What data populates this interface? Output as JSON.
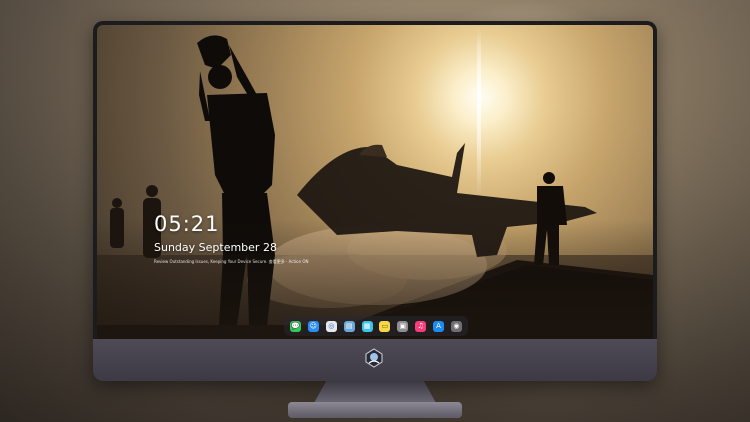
{
  "lockscreen": {
    "time": "05:21",
    "date": "Sunday September  28",
    "notice": "Review Outstanding Issues, Keeping Your Device Secure. 查看更多 · Action ON"
  },
  "dock": {
    "icons": [
      {
        "name": "messages-icon",
        "color": "#35c759",
        "glyph": "💬"
      },
      {
        "name": "finder-icon",
        "color": "#2d8cf0",
        "glyph": "☺"
      },
      {
        "name": "safari-icon",
        "color": "#e8e8ec",
        "glyph": "◎"
      },
      {
        "name": "preview-icon",
        "color": "#6aa9d8",
        "glyph": "▤"
      },
      {
        "name": "photos-icon",
        "color": "#3ec4e6",
        "glyph": "▦"
      },
      {
        "name": "notes-icon",
        "color": "#f6d74a",
        "glyph": "▭"
      },
      {
        "name": "system-preferences-icon",
        "color": "#8e8e93",
        "glyph": "▣"
      },
      {
        "name": "music-icon",
        "color": "#fa3c7a",
        "glyph": "♫"
      },
      {
        "name": "app-store-icon",
        "color": "#1c8cf5",
        "glyph": "A"
      },
      {
        "name": "camera-icon",
        "color": "#6e6e73",
        "glyph": "◉"
      }
    ]
  },
  "colors": {
    "monitor_bezel": "#1c1c1f",
    "chin": "#4f4b56",
    "accent": "#ffffff"
  }
}
